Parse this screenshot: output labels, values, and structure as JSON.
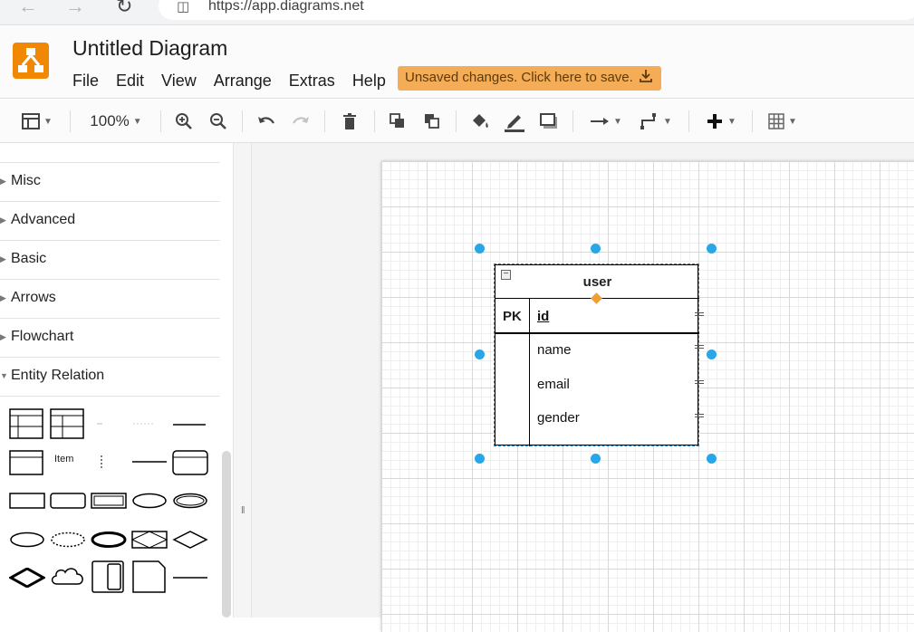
{
  "browser": {
    "back": "←",
    "forward": "→",
    "reload": "↻",
    "url": "https://app.diagrams.net"
  },
  "header": {
    "title": "Untitled Diagram",
    "menu": [
      "File",
      "Edit",
      "View",
      "Arrange",
      "Extras",
      "Help"
    ],
    "save_notice": "Unsaved changes. Click here to save.",
    "accent": "#f08705",
    "banner_color": "#f5ac56"
  },
  "toolbar": {
    "zoom": "100%",
    "icons": [
      "format-panel-icon",
      "zoom-in-icon",
      "zoom-out-icon",
      "undo-icon",
      "redo-icon",
      "delete-icon",
      "to-front-icon",
      "to-back-icon",
      "fill-color-icon",
      "line-color-icon",
      "shadow-icon",
      "connection-icon",
      "waypoints-icon",
      "insert-icon",
      "table-icon"
    ]
  },
  "sidebar": {
    "sections": [
      {
        "label": "Misc",
        "expanded": false
      },
      {
        "label": "Advanced",
        "expanded": false
      },
      {
        "label": "Basic",
        "expanded": false
      },
      {
        "label": "Arrows",
        "expanded": false
      },
      {
        "label": "Flowchart",
        "expanded": false
      },
      {
        "label": "Entity Relation",
        "expanded": true
      }
    ],
    "shape_item_label": "Item"
  },
  "entity": {
    "title": "user",
    "pk_label": "PK",
    "key_field": "id",
    "fields": [
      "name",
      "email",
      "gender"
    ],
    "selection_color": "#29a6e8"
  }
}
